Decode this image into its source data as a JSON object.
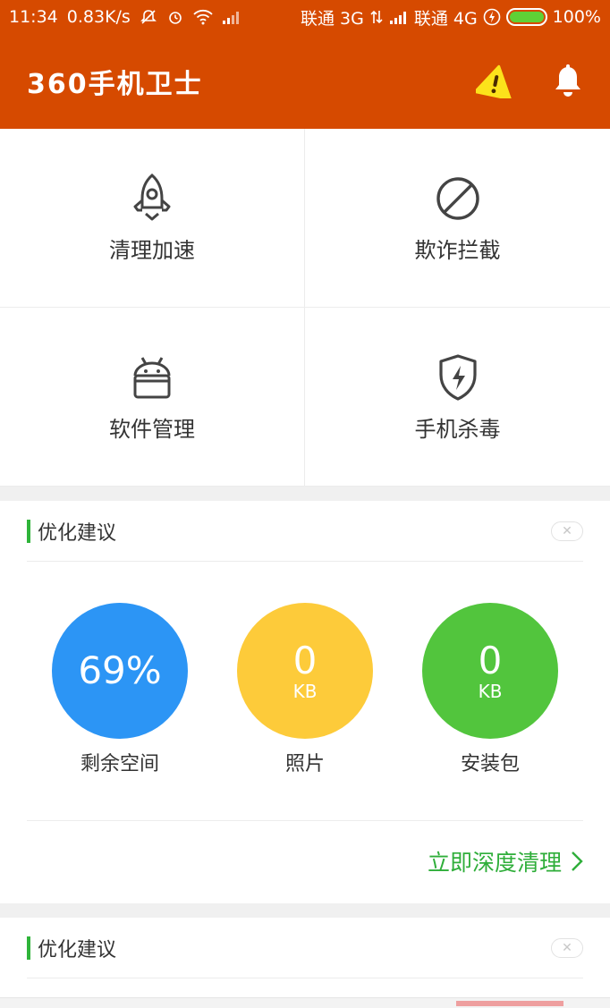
{
  "status_bar": {
    "time": "11:34",
    "speed": "0.83K/s",
    "carrier1": "联通 3G",
    "carrier2": "联通 4G",
    "battery": "100%",
    "battery_level": 1.0
  },
  "app_bar": {
    "title": "360手机卫士",
    "warning_icon": "warning-icon",
    "bell_icon": "bell-icon"
  },
  "grid": [
    {
      "label": "清理加速",
      "icon": "rocket-icon"
    },
    {
      "label": "欺诈拦截",
      "icon": "block-icon"
    },
    {
      "label": "软件管理",
      "icon": "android-icon"
    },
    {
      "label": "手机杀毒",
      "icon": "shield-icon"
    }
  ],
  "card1": {
    "title": "优化建议",
    "stats": [
      {
        "value": "69%",
        "unit": "",
        "label": "剩余空间",
        "color": "#2c95f5"
      },
      {
        "value": "0",
        "unit": "KB",
        "label": "照片",
        "color": "#fdcb3a"
      },
      {
        "value": "0",
        "unit": "KB",
        "label": "安装包",
        "color": "#52c53d"
      }
    ],
    "action": "立即深度清理"
  },
  "card2": {
    "title": "优化建议"
  },
  "colors": {
    "brand": "#d64a00",
    "accent_green": "#2fae3a"
  }
}
